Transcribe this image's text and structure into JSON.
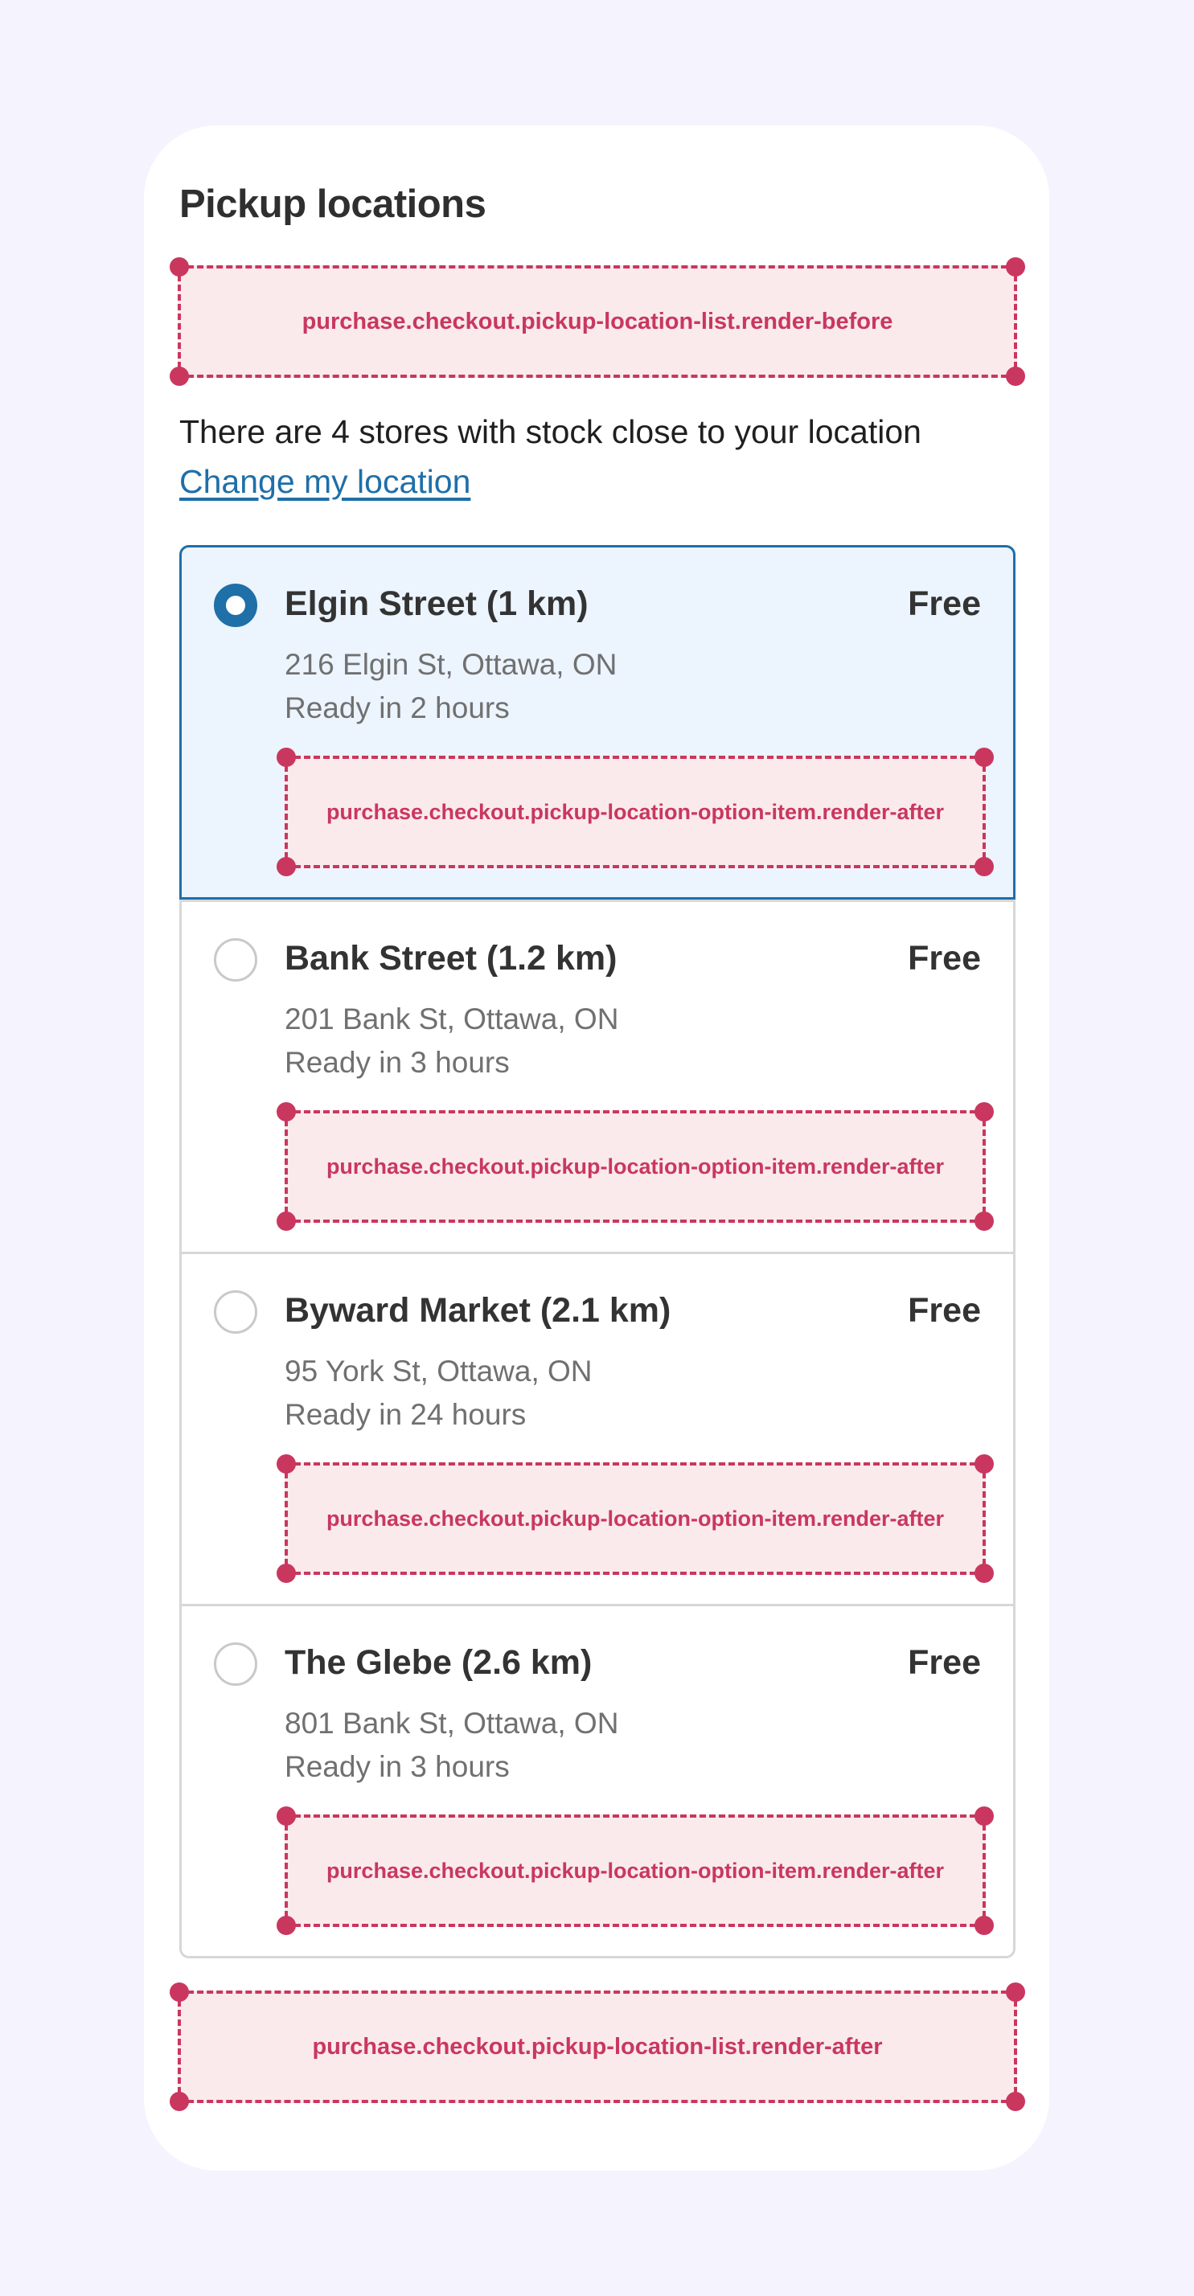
{
  "title": "Pickup locations",
  "extensions": {
    "list_before": "purchase.checkout.pickup-location-list.render-before",
    "list_after": "purchase.checkout.pickup-location-list.render-after",
    "item_after": "purchase.checkout.pickup-location-option-item.render-after"
  },
  "stock_message": "There are 4 stores with stock close to your location",
  "change_location_link": "Change my location",
  "options": [
    {
      "name": "Elgin Street (1 km)",
      "price": "Free",
      "address": "216 Elgin St, Ottawa, ON",
      "ready": "Ready in 2 hours",
      "selected": true
    },
    {
      "name": "Bank Street (1.2 km)",
      "price": "Free",
      "address": "201 Bank St, Ottawa, ON",
      "ready": "Ready in 3 hours",
      "selected": false
    },
    {
      "name": "Byward Market (2.1 km)",
      "price": "Free",
      "address": "95 York St, Ottawa, ON",
      "ready": "Ready in 24 hours",
      "selected": false
    },
    {
      "name": "The Glebe (2.6 km)",
      "price": "Free",
      "address": "801 Bank St, Ottawa, ON",
      "ready": "Ready in 3 hours",
      "selected": false
    }
  ],
  "colors": {
    "background": "#f4f3fe",
    "accent": "#1f6fa8",
    "selected_bg": "#ecf4fe",
    "extension": "#c9375f",
    "extension_bg": "#faeaec"
  }
}
